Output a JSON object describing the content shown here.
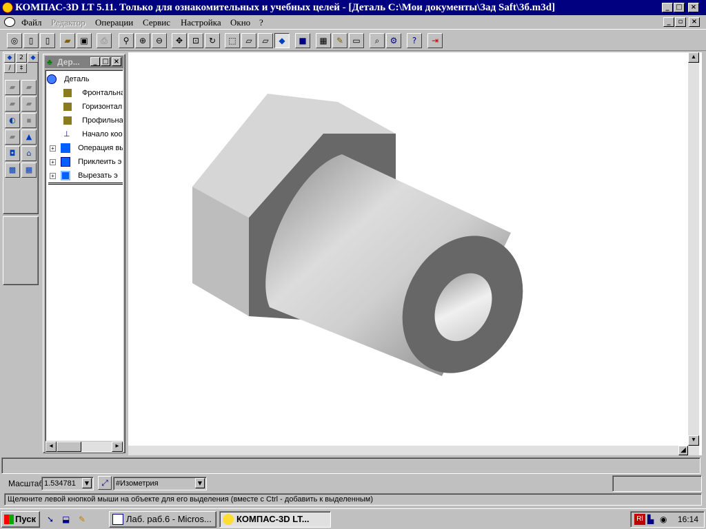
{
  "window": {
    "title": "КОМПАС-3D LT 5.11. Только для ознакомительных и учебных целей - [Деталь C:\\Мои документы\\Зад Saft\\3б.m3d]",
    "controls": [
      "_",
      "□",
      "×"
    ]
  },
  "menu": [
    {
      "label": "Файл",
      "enabled": true
    },
    {
      "label": "Редактор",
      "enabled": false
    },
    {
      "label": "Операции",
      "enabled": true
    },
    {
      "label": "Сервис",
      "enabled": true
    },
    {
      "label": "Настройка",
      "enabled": true
    },
    {
      "label": "Окно",
      "enabled": true
    },
    {
      "label": "?",
      "enabled": true
    }
  ],
  "tree": {
    "title": "Дер...",
    "items": [
      {
        "label": "Деталь",
        "icon": "part-icon"
      },
      {
        "label": "Фронтальна",
        "icon": "plane-icon"
      },
      {
        "label": "Горизонталь",
        "icon": "plane-icon"
      },
      {
        "label": "Профильная",
        "icon": "plane-icon"
      },
      {
        "label": "Начало коор",
        "icon": "origin-icon"
      },
      {
        "label": "Операция вы",
        "icon": "extrude-icon"
      },
      {
        "label": "Приклеить э",
        "icon": "boss-icon"
      },
      {
        "label": "Вырезать э",
        "icon": "cut-icon"
      }
    ]
  },
  "properties": {
    "scale_label": "Масштаб",
    "scale_value": "1.534781",
    "view_value": "#Изометрия"
  },
  "hint": "Щелкните левой кнопкой мыши на объекте для его выделения (вместе с Ctrl - добавить к выделенным)",
  "taskbar": {
    "start": "Пуск",
    "tasks": [
      "Лаб. раб.6 - Micros...",
      "КОМПАС-3D LT..."
    ],
    "lang": "Rl",
    "clock": "16:14"
  },
  "colors": {
    "titlebar": "#000080",
    "face": "#c0c0c0",
    "model_light": "#d8d8d8",
    "model_dark": "#666666"
  }
}
